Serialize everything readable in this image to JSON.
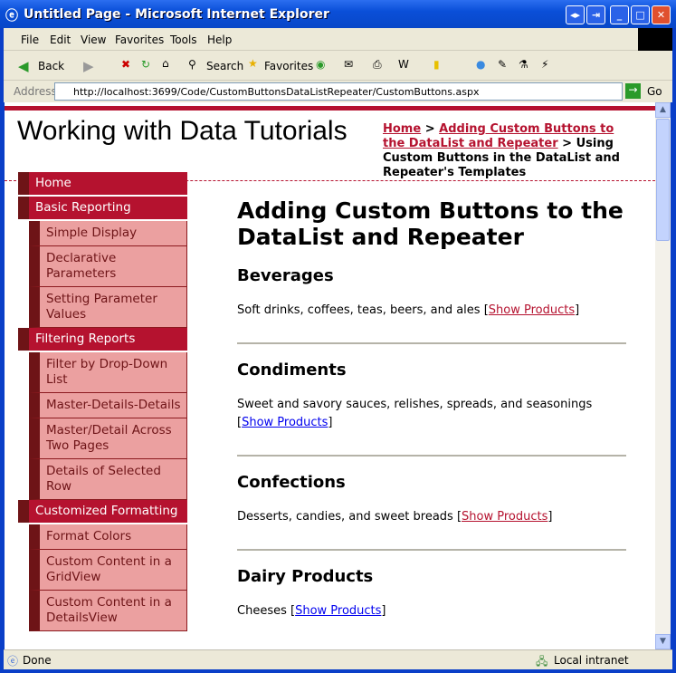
{
  "window": {
    "title": "Untitled Page - Microsoft Internet Explorer"
  },
  "menu": [
    "File",
    "Edit",
    "View",
    "Favorites",
    "Tools",
    "Help"
  ],
  "toolbar": {
    "back": "Back",
    "search": "Search",
    "favorites": "Favorites"
  },
  "address": {
    "label": "Address",
    "url": "http://localhost:3699/Code/CustomButtonsDataListRepeater/CustomButtons.aspx",
    "go": "Go"
  },
  "page": {
    "site_title": "Working with Data Tutorials",
    "breadcrumb": {
      "home": "Home",
      "sep1": " > ",
      "parent": "Adding Custom Buttons to the DataList and Repeater",
      "sep2": " > ",
      "current": "Using Custom Buttons in the DataList and Repeater's Templates"
    },
    "nav": [
      {
        "label": "Home",
        "level": "top"
      },
      {
        "label": "Basic Reporting",
        "level": "top"
      },
      {
        "label": "Simple Display",
        "level": "sub"
      },
      {
        "label": "Declarative Parameters",
        "level": "sub"
      },
      {
        "label": "Setting Parameter Values",
        "level": "sub"
      },
      {
        "label": "Filtering Reports",
        "level": "top"
      },
      {
        "label": "Filter by Drop-Down List",
        "level": "sub"
      },
      {
        "label": "Master-Details-Details",
        "level": "sub"
      },
      {
        "label": "Master/Detail Across Two Pages",
        "level": "sub"
      },
      {
        "label": "Details of Selected Row",
        "level": "sub"
      },
      {
        "label": "Customized Formatting",
        "level": "top"
      },
      {
        "label": "Format Colors",
        "level": "sub"
      },
      {
        "label": "Custom Content in a GridView",
        "level": "sub"
      },
      {
        "label": "Custom Content in a DetailsView",
        "level": "sub"
      }
    ],
    "heading": "Adding Custom Buttons to the DataList and Repeater",
    "categories": [
      {
        "name": "Beverages",
        "description": "Soft drinks, coffees, teas, beers, and ales",
        "link": "Show Products",
        "visited": true
      },
      {
        "name": "Condiments",
        "description": "Sweet and savory sauces, relishes, spreads, and seasonings",
        "link": "Show Products",
        "visited": false
      },
      {
        "name": "Confections",
        "description": "Desserts, candies, and sweet breads",
        "link": "Show Products",
        "visited": true
      },
      {
        "name": "Dairy Products",
        "description": "Cheeses",
        "link": "Show Products",
        "visited": false
      }
    ]
  },
  "status": {
    "text": "Done",
    "zone": "Local intranet"
  },
  "colors": {
    "brand": "#b5122f",
    "nav_dark": "#6e1417",
    "nav_sub": "#eba0a0",
    "link": "#0000ee",
    "visited": "#b5122f"
  }
}
